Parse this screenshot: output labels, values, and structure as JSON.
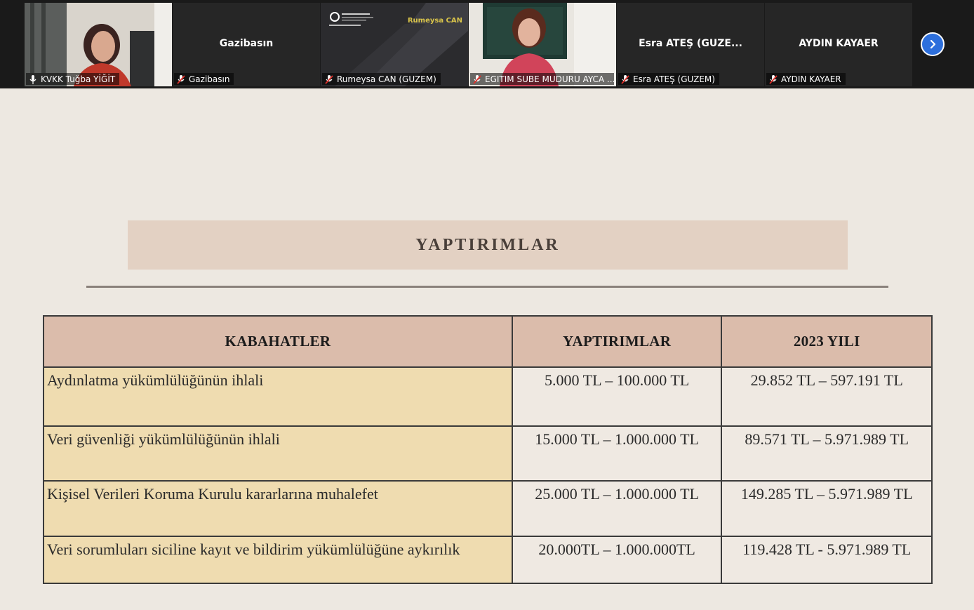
{
  "participants": [
    {
      "label": "KVKK Tuğba YİĞİT",
      "big_name": "",
      "video": true,
      "active": true,
      "mic": "speaking"
    },
    {
      "label": "Gazibasın",
      "big_name": "Gazibasın",
      "video": false,
      "active": false,
      "mic": "muted"
    },
    {
      "label": "Rumeysa CAN (GUZEM)",
      "big_name": "",
      "video": true,
      "active": false,
      "mic": "muted",
      "overlay_text": "Rumeysa CAN"
    },
    {
      "label": "EGITIM SUBE MUDURU AYCA ...",
      "big_name": "",
      "video": true,
      "active": false,
      "mic": "muted"
    },
    {
      "label": "Esra ATEŞ (GUZEM)",
      "big_name": "Esra ATEŞ (GUZE...",
      "video": false,
      "active": false,
      "mic": "muted"
    },
    {
      "label": "AYDIN KAYAER",
      "big_name": "AYDIN KAYAER",
      "video": false,
      "active": false,
      "mic": "muted"
    }
  ],
  "controls": {
    "next_icon": "chevron-right-icon",
    "accent": "#2d6fdc"
  },
  "slide": {
    "title": "YAPTIRIMLAR",
    "table": {
      "headers": [
        "KABAHATLER",
        "YAPTIRIMLAR",
        "2023 YILI"
      ],
      "rows": [
        [
          "Aydınlatma yükümlülüğünün ihlali",
          "5.000 TL – 100.000  TL",
          "29.852 TL – 597.191 TL"
        ],
        [
          "Veri güvenliği yükümlülüğünün ihlali",
          "15.000 TL – 1.000.000  TL",
          "89.571 TL – 5.971.989 TL"
        ],
        [
          "Kişisel Verileri Koruma Kurulu kararlarına muhalefet",
          "25.000 TL – 1.000.000  TL",
          "149.285 TL – 5.971.989 TL"
        ],
        [
          "Veri sorumluları siciline kayıt ve bildirim yükümlülüğüne aykırılık",
          "20.000TL – 1.000.000TL",
          "119.428 TL - 5.971.989 TL"
        ]
      ]
    }
  },
  "colors": {
    "title_band": "#e3d1c3",
    "header_fill": "#dbbcab",
    "first_col_fill": "#efdcb0",
    "slide_bg": "#ede8e1"
  }
}
